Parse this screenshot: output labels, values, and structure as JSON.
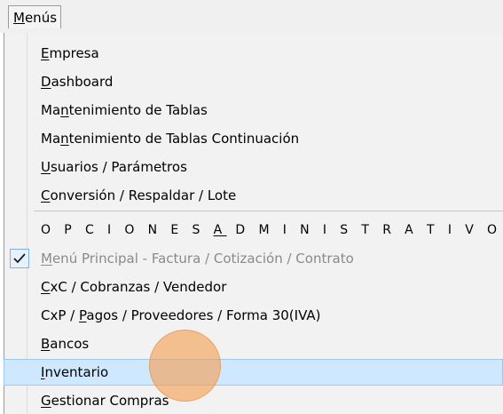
{
  "menubar": {
    "menu_label_pre": "",
    "menu_label_u": "M",
    "menu_label_post": "enús"
  },
  "menu": {
    "items": [
      {
        "pre": "",
        "u": "E",
        "post": "mpresa"
      },
      {
        "pre": "",
        "u": "D",
        "post": "ashboard"
      },
      {
        "pre": "Ma",
        "u": "n",
        "post": "tenimiento de Tablas"
      },
      {
        "pre": "Ma",
        "u": "n",
        "post": "tenimiento de Tablas Continuación"
      },
      {
        "pre": "",
        "u": "U",
        "post": "suarios / Parámetros"
      },
      {
        "pre": "",
        "u": "C",
        "post": "onversión / Respaldar / Lote"
      },
      {
        "pre": "O P C I O N E S  ",
        "u": "A",
        "post": " D M I N I S T R A T I V O"
      },
      {
        "pre": "",
        "u": "M",
        "post": "enú Principal - Factura / Cotización / Contrato"
      },
      {
        "pre": "",
        "u": "C",
        "post": "xC / Cobranzas / Vendedor"
      },
      {
        "pre": "CxP / ",
        "u": "P",
        "post": "agos / Proveedores / Forma 30(IVA)"
      },
      {
        "pre": "",
        "u": "B",
        "post": "ancos"
      },
      {
        "pre": "",
        "u": "I",
        "post": "nventario"
      },
      {
        "pre": "",
        "u": "G",
        "post": "estionar Compras"
      }
    ]
  },
  "colors": {
    "highlight": "#cde8ff",
    "highlight_border": "#99c9f1",
    "disabled_text": "#8a8a8a",
    "cursor_circle": "#f6a050"
  },
  "icons": {
    "checked_item": "checkmark-icon"
  }
}
